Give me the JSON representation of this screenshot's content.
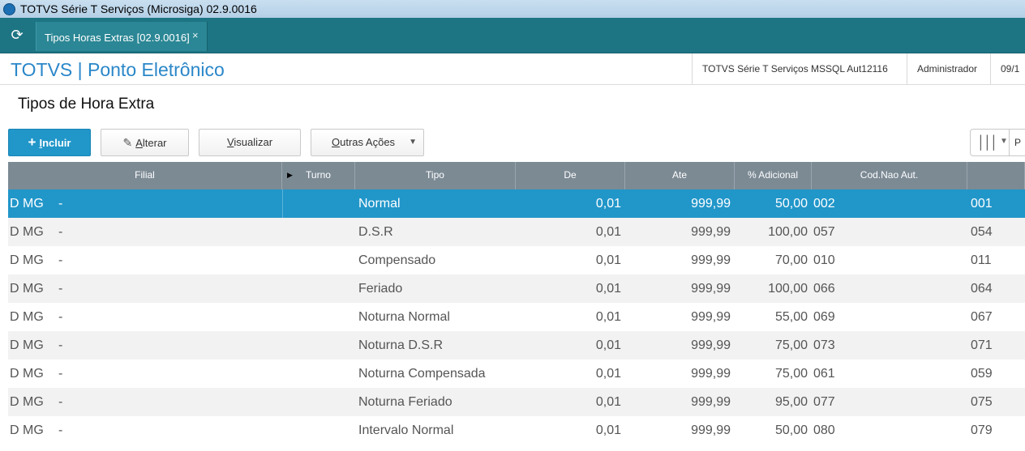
{
  "window": {
    "title": "TOTVS Série T Serviços (Microsiga) 02.9.0016"
  },
  "tabs": [
    {
      "label": "Tipos Horas Extras [02.9.0016]",
      "close": "×"
    }
  ],
  "header": {
    "brand": "TOTVS | Ponto Eletrônico",
    "environment": "TOTVS Série T Serviços MSSQL Aut12116",
    "user": "Administrador",
    "date": "09/1"
  },
  "page": {
    "title": "Tipos de Hora Extra"
  },
  "toolbar": {
    "include_plus": "+",
    "include_label_u": "I",
    "include_label_rest": "ncluir",
    "alter_label_u": "A",
    "alter_label_rest": "lterar",
    "view_label_u": "V",
    "view_label_rest": "isualizar",
    "other_label_u": "O",
    "other_label_rest": "utras Ações",
    "view_toggle_text": "P"
  },
  "table": {
    "columns": [
      "Filial",
      "Turno",
      "Tipo",
      "De",
      "Ate",
      "% Adicional",
      "Cod.Nao Aut.",
      ""
    ],
    "selected_row": 0,
    "rows": [
      {
        "filial": "D MG",
        "dash": "-",
        "turno": "",
        "tipo": "Normal",
        "de": "0,01",
        "ate": "999,99",
        "adicional": "50,00",
        "cod_nao_aut": "002",
        "cod2": "001"
      },
      {
        "filial": "D MG",
        "dash": "-",
        "turno": "",
        "tipo": "D.S.R",
        "de": "0,01",
        "ate": "999,99",
        "adicional": "100,00",
        "cod_nao_aut": "057",
        "cod2": "054"
      },
      {
        "filial": "D MG",
        "dash": "-",
        "turno": "",
        "tipo": "Compensado",
        "de": "0,01",
        "ate": "999,99",
        "adicional": "70,00",
        "cod_nao_aut": "010",
        "cod2": "011"
      },
      {
        "filial": "D MG",
        "dash": "-",
        "turno": "",
        "tipo": "Feriado",
        "de": "0,01",
        "ate": "999,99",
        "adicional": "100,00",
        "cod_nao_aut": "066",
        "cod2": "064"
      },
      {
        "filial": "D MG",
        "dash": "-",
        "turno": "",
        "tipo": "Noturna Normal",
        "de": "0,01",
        "ate": "999,99",
        "adicional": "55,00",
        "cod_nao_aut": "069",
        "cod2": "067"
      },
      {
        "filial": "D MG",
        "dash": "-",
        "turno": "",
        "tipo": "Noturna D.S.R",
        "de": "0,01",
        "ate": "999,99",
        "adicional": "75,00",
        "cod_nao_aut": "073",
        "cod2": "071"
      },
      {
        "filial": "D MG",
        "dash": "-",
        "turno": "",
        "tipo": "Noturna Compensada",
        "de": "0,01",
        "ate": "999,99",
        "adicional": "75,00",
        "cod_nao_aut": "061",
        "cod2": "059"
      },
      {
        "filial": "D MG",
        "dash": "-",
        "turno": "",
        "tipo": "Noturna Feriado",
        "de": "0,01",
        "ate": "999,99",
        "adicional": "95,00",
        "cod_nao_aut": "077",
        "cod2": "075"
      },
      {
        "filial": "D MG",
        "dash": "-",
        "turno": "",
        "tipo": "Intervalo Normal",
        "de": "0,01",
        "ate": "999,99",
        "adicional": "50,00",
        "cod_nao_aut": "080",
        "cod2": "079"
      }
    ]
  },
  "colors": {
    "accent": "#2196c9",
    "tabbar": "#1d7584",
    "grid_header": "#7c8a94",
    "brand": "#2a87c9"
  }
}
